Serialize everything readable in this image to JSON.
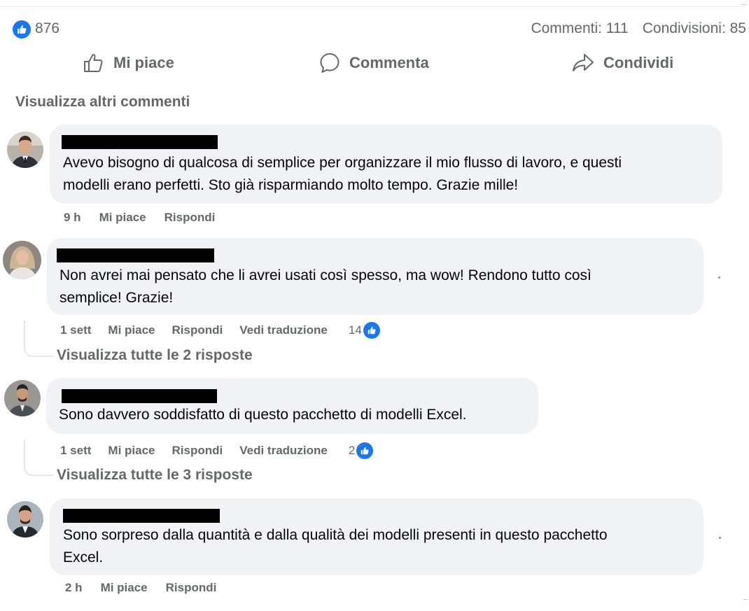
{
  "post_stats": {
    "likes": "876",
    "comments": "Commenti: 111",
    "shares": "Condivisioni: 85"
  },
  "actions": {
    "like": "Mi piace",
    "comment": "Commenta",
    "share": "Condividi"
  },
  "view_more_comments": "Visualizza altri commenti",
  "comments": [
    {
      "text_line1": "Avevo bisogno di qualcosa di semplice per organizzare il mio flusso di lavoro, e questi",
      "text_line2": "modelli erano perfetti. Sto già risparmiando molto tempo. Grazie mille!",
      "time": "9 h",
      "like": "Mi piace",
      "reply": "Rispondi"
    },
    {
      "text_line1": "Non avrei mai pensato che li avrei usati così spesso, ma wow! Rendono tutto così",
      "text_line2": "semplice! Grazie!",
      "time": "1 sett",
      "like": "Mi piace",
      "reply": "Rispondi",
      "translate": "Vedi traduzione",
      "reactions": "14",
      "view_replies": "Visualizza tutte le 2 risposte"
    },
    {
      "text_line1": "Sono davvero soddisfatto di questo pacchetto di modelli Excel.",
      "time": "1 sett",
      "like": "Mi piace",
      "reply": "Rispondi",
      "translate": "Vedi traduzione",
      "reactions": "2",
      "view_replies": "Visualizza tutte le 3 risposte"
    },
    {
      "text_line1": "Sono sorpreso dalla quantità e dalla qualità dei modelli presenti in questo pacchetto",
      "text_line2": "Excel.",
      "time": "2 h",
      "like": "Mi piace",
      "reply": "Rispondi"
    }
  ],
  "icons": {
    "like_badge": "thumbs-up-icon",
    "like_action": "thumbs-up-outline-icon",
    "comment_action": "speech-bubble-icon",
    "share_action": "share-arrow-icon"
  },
  "colors": {
    "accent": "#1877f2",
    "muted_text": "#65676b",
    "bubble_bg": "#f0f2f5"
  }
}
